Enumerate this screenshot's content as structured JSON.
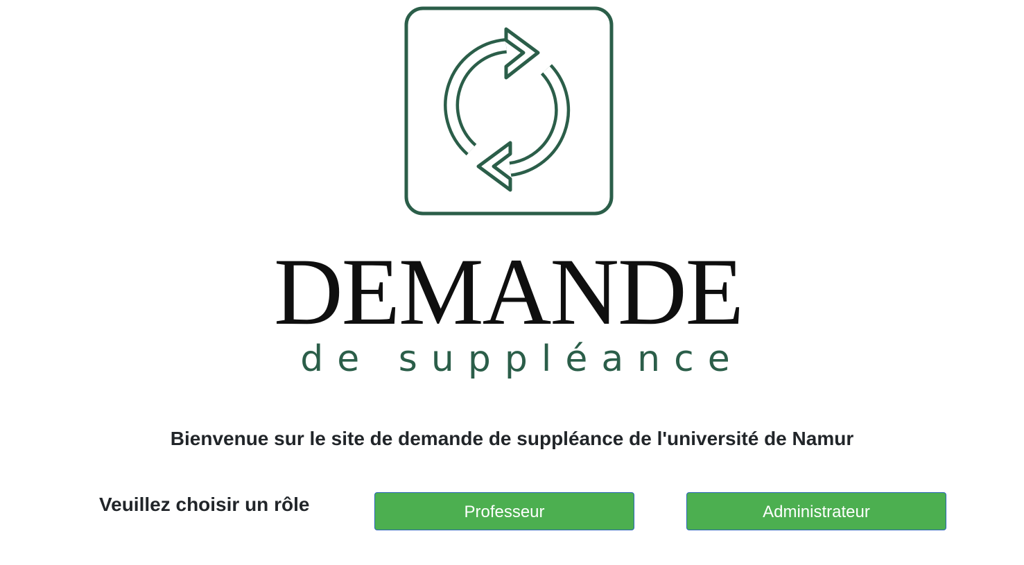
{
  "logo": {
    "title": "DEMANDE",
    "subtitle": "de suppléance",
    "icon": "refresh-arrows-icon",
    "color": "#2b5e49"
  },
  "welcome_text": "Bienvenue sur le site de demande de suppléance de l'université de Namur",
  "role_prompt": "Veuillez choisir un rôle",
  "buttons": {
    "professor_label": "Professeur",
    "admin_label": "Administrateur",
    "color": "#4caf50"
  }
}
